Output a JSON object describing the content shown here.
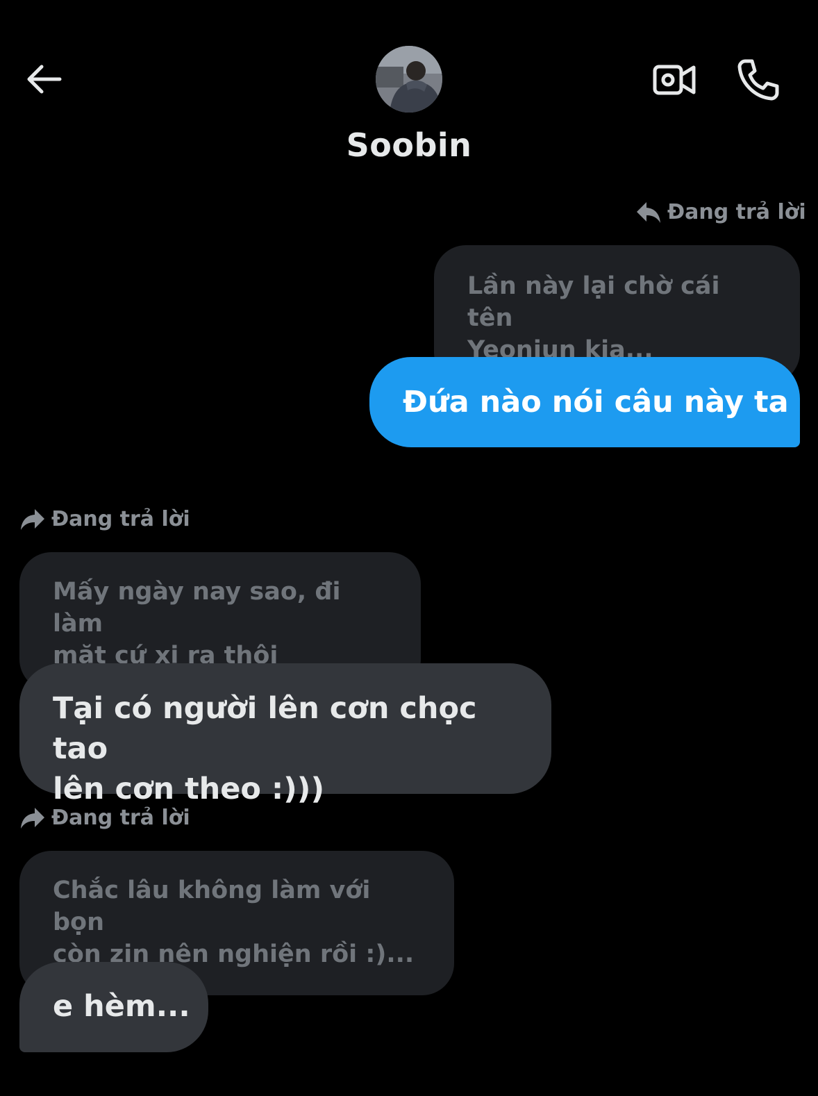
{
  "header": {
    "contact_name": "Soobin",
    "icons": [
      "back-arrow-icon",
      "video-camera-icon",
      "phone-icon"
    ]
  },
  "conversation": [
    {
      "reply_label": "Đang trả lời",
      "quoted_text": "Lần này lại chờ cái tên\nYeonjun kia...",
      "message": "Đứa nào nói câu này ta",
      "direction": "sent"
    },
    {
      "reply_label": "Đang trả lời",
      "quoted_text": "Mấy ngày nay sao, đi làm\nmặt cứ xị ra thôi",
      "message": "Tại có người lên cơn chọc tao\nlên cơn theo :)))",
      "direction": "received"
    },
    {
      "reply_label": "Đang trả lời",
      "quoted_text": "Chắc lâu không làm với bọn\ncòn zin nên nghiện rồi :)...",
      "message": "e hèm...",
      "direction": "received"
    }
  ],
  "colors": {
    "background": "#000000",
    "sent_bubble": "#1d9bf0",
    "received_bubble": "#33363b",
    "quoted_bubble": "#1e2024",
    "muted_text": "#8b9096"
  }
}
